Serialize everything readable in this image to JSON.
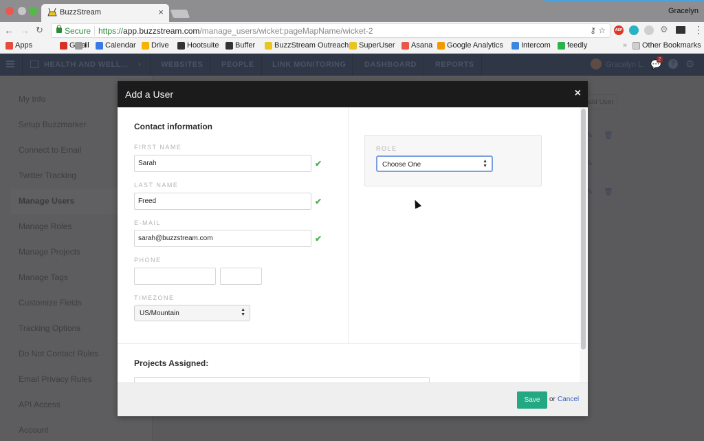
{
  "browser": {
    "tab_title": "BuzzStream",
    "profile_name": "Gracelyn",
    "secure_label": "Secure",
    "url_scheme": "https://",
    "url_host": "app.buzzstream.com",
    "url_path": "/manage_users/wicket:pageMapName/wicket-2",
    "bookmarks": [
      {
        "label": "Apps",
        "icon": "apps-grid-icon",
        "color": "#e44d3a"
      },
      {
        "label": "Gmail",
        "icon": "gmail-icon",
        "color": "#d93025"
      },
      {
        "label": "I",
        "icon": "folder-icon",
        "color": "#9a9a9a"
      },
      {
        "label": "Calendar",
        "icon": "calendar-icon",
        "color": "#3b78e7"
      },
      {
        "label": "Drive",
        "icon": "drive-icon",
        "color": "#f4b400"
      },
      {
        "label": "Hootsuite",
        "icon": "hootsuite-icon",
        "color": "#333333"
      },
      {
        "label": "Buffer",
        "icon": "buffer-icon",
        "color": "#333333"
      },
      {
        "label": "BuzzStream Outreach",
        "icon": "buzzstream-icon",
        "color": "#e8c51f"
      },
      {
        "label": "SuperUser",
        "icon": "buzzstream-icon",
        "color": "#e8c51f"
      },
      {
        "label": "Asana",
        "icon": "asana-icon",
        "color": "#e8574a"
      },
      {
        "label": "Google Analytics",
        "icon": "analytics-icon",
        "color": "#f29900"
      },
      {
        "label": "Intercom",
        "icon": "intercom-icon",
        "color": "#3b86e0"
      },
      {
        "label": "feedly",
        "icon": "feedly-icon",
        "color": "#2bb24c"
      }
    ],
    "other_bookmarks": "Other Bookmarks",
    "overflow": "»"
  },
  "appnav": {
    "project": "HEALTH AND WELL...",
    "items": [
      "WEBSITES",
      "PEOPLE",
      "LINK MONITORING",
      "DASHBOARD",
      "REPORTS"
    ],
    "user_name": "Gracelyn L.",
    "notification_count": "2"
  },
  "sidebar": {
    "items": [
      {
        "label": "My Info",
        "active": false
      },
      {
        "label": "Setup Buzzmarker",
        "active": false
      },
      {
        "label": "Connect to Email",
        "active": false
      },
      {
        "label": "Twitter Tracking",
        "active": false
      },
      {
        "label": "Manage Users",
        "active": true
      },
      {
        "label": "Manage Roles",
        "active": false
      },
      {
        "label": "Manage Projects",
        "active": false
      },
      {
        "label": "Manage Tags",
        "active": false
      },
      {
        "label": "Customize Fields",
        "active": false
      },
      {
        "label": "Tracking Options",
        "active": false
      },
      {
        "label": "Do Not Contact Rules",
        "active": false
      },
      {
        "label": "Email Privacy Rules",
        "active": false
      },
      {
        "label": "API Access",
        "active": false
      },
      {
        "label": "Account",
        "active": false
      }
    ]
  },
  "background": {
    "add_user_label": "Add User"
  },
  "modal": {
    "title": "Add a User",
    "close": "×",
    "contact_section": "Contact information",
    "fields": {
      "first_name": {
        "label": "FIRST NAME",
        "value": "Sarah",
        "valid": true
      },
      "last_name": {
        "label": "LAST NAME",
        "value": "Freed",
        "valid": true
      },
      "email": {
        "label": "E-MAIL",
        "value": "sarah@buzzstream.com",
        "valid": true
      },
      "phone": {
        "label": "PHONE",
        "value": "",
        "ext_value": ""
      },
      "timezone": {
        "label": "TIMEZONE",
        "value": "US/Mountain"
      }
    },
    "role": {
      "label": "ROLE",
      "value": "Choose One"
    },
    "projects_section": "Projects Assigned:",
    "save_label": "Save",
    "or_label": "or",
    "cancel_label": "Cancel",
    "check_glyph": "✔",
    "select_arrows": "▲▼"
  },
  "colors": {
    "save_green": "#23a883",
    "cancel_blue": "#3860c2",
    "check_green": "#4caf50",
    "focus_blue": "#7b9fe0"
  }
}
